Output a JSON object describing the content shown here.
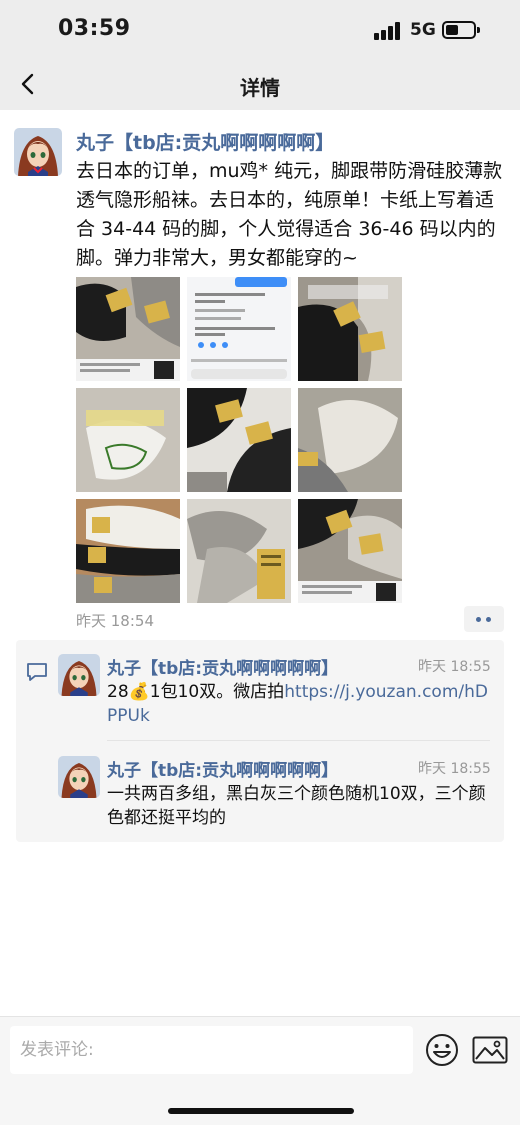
{
  "status_bar": {
    "time": "03:59",
    "network": "5G"
  },
  "nav": {
    "title": "详情",
    "back_icon": "chevron-left-icon"
  },
  "post": {
    "author": "丸子【tb店:贡丸啊啊啊啊啊】",
    "text": "去日本的订单，mu鸡* 纯元，脚跟带防滑硅胶薄款透气隐形船袜。去日本的，纯原单！卡纸上写着适合 34-44 码的脚，个人觉得适合 36-46 码以内的脚。弹力非常大，男女都能穿的~",
    "time": "昨天 18:54",
    "photos": [
      {
        "name": "photo-socks-1"
      },
      {
        "name": "photo-chat-screenshot"
      },
      {
        "name": "photo-socks-3"
      },
      {
        "name": "photo-socks-4"
      },
      {
        "name": "photo-socks-5"
      },
      {
        "name": "photo-socks-6"
      },
      {
        "name": "photo-socks-7"
      },
      {
        "name": "photo-socks-8"
      },
      {
        "name": "photo-socks-9"
      }
    ]
  },
  "comments": [
    {
      "author": "丸子【tb店:贡丸啊啊啊啊啊】",
      "time": "昨天 18:55",
      "text_prefix": "28💰1包10双。微店拍",
      "link": "https://j.youzan.com/hDPPUk"
    },
    {
      "author": "丸子【tb店:贡丸啊啊啊啊啊】",
      "time": "昨天 18:55",
      "text": "一共两百多组，黑白灰三个颜色随机10双，三个颜色都还挺平均的"
    }
  ],
  "composer": {
    "placeholder": "发表评论:"
  }
}
